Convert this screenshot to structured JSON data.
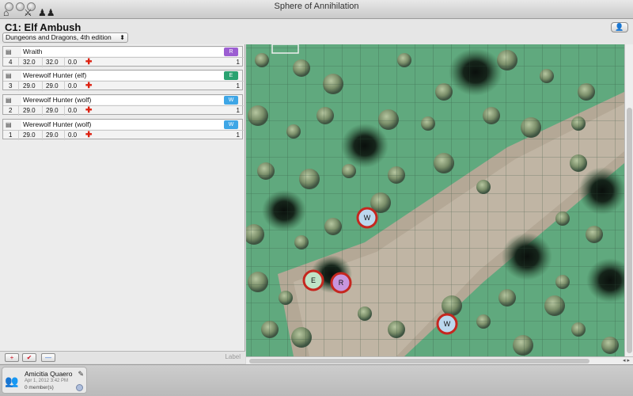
{
  "window": {
    "title": "Sphere of Annihilation"
  },
  "toolbar": {
    "icons": [
      "home-icon",
      "crossed-swords-icon",
      "party-icon"
    ]
  },
  "encounter": {
    "title": "C1: Elf Ambush",
    "edition": "Dungeons and Dragons, 4th edition",
    "players_button": "👤"
  },
  "combatants": [
    {
      "name": "Wraith",
      "init": "4",
      "hp": "32.0",
      "max_hp": "32.0",
      "temp": "0.0",
      "badge": "R",
      "badge_color": "#9c5ed2",
      "count": "1"
    },
    {
      "name": "Werewolf Hunter (elf)",
      "init": "3",
      "hp": "29.0",
      "max_hp": "29.0",
      "temp": "0.0",
      "badge": "E",
      "badge_color": "#2aa271",
      "count": "1"
    },
    {
      "name": "Werewolf Hunter (wolf)",
      "init": "2",
      "hp": "29.0",
      "max_hp": "29.0",
      "temp": "0.0",
      "badge": "W",
      "badge_color": "#3ea6e6",
      "count": "1"
    },
    {
      "name": "Werewolf Hunter (wolf)",
      "init": "1",
      "hp": "29.0",
      "max_hp": "29.0",
      "temp": "0.0",
      "badge": "W",
      "badge_color": "#3ea6e6",
      "count": "1"
    }
  ],
  "footer": {
    "add_label": "+",
    "tool_label": "✔",
    "remove_label": "—",
    "label_text": "Label"
  },
  "map": {
    "tokens": [
      {
        "letter": "W",
        "fill": "#bcd8ef"
      },
      {
        "letter": "E",
        "fill": "#bfe3c7"
      },
      {
        "letter": "R",
        "fill": "#c896de"
      },
      {
        "letter": "W",
        "fill": "#bcd8ef"
      }
    ]
  },
  "party": {
    "name": "Amicitia Quaero",
    "date": "Apr 1, 2012 3:42 PM",
    "members": "0 member(s)"
  }
}
